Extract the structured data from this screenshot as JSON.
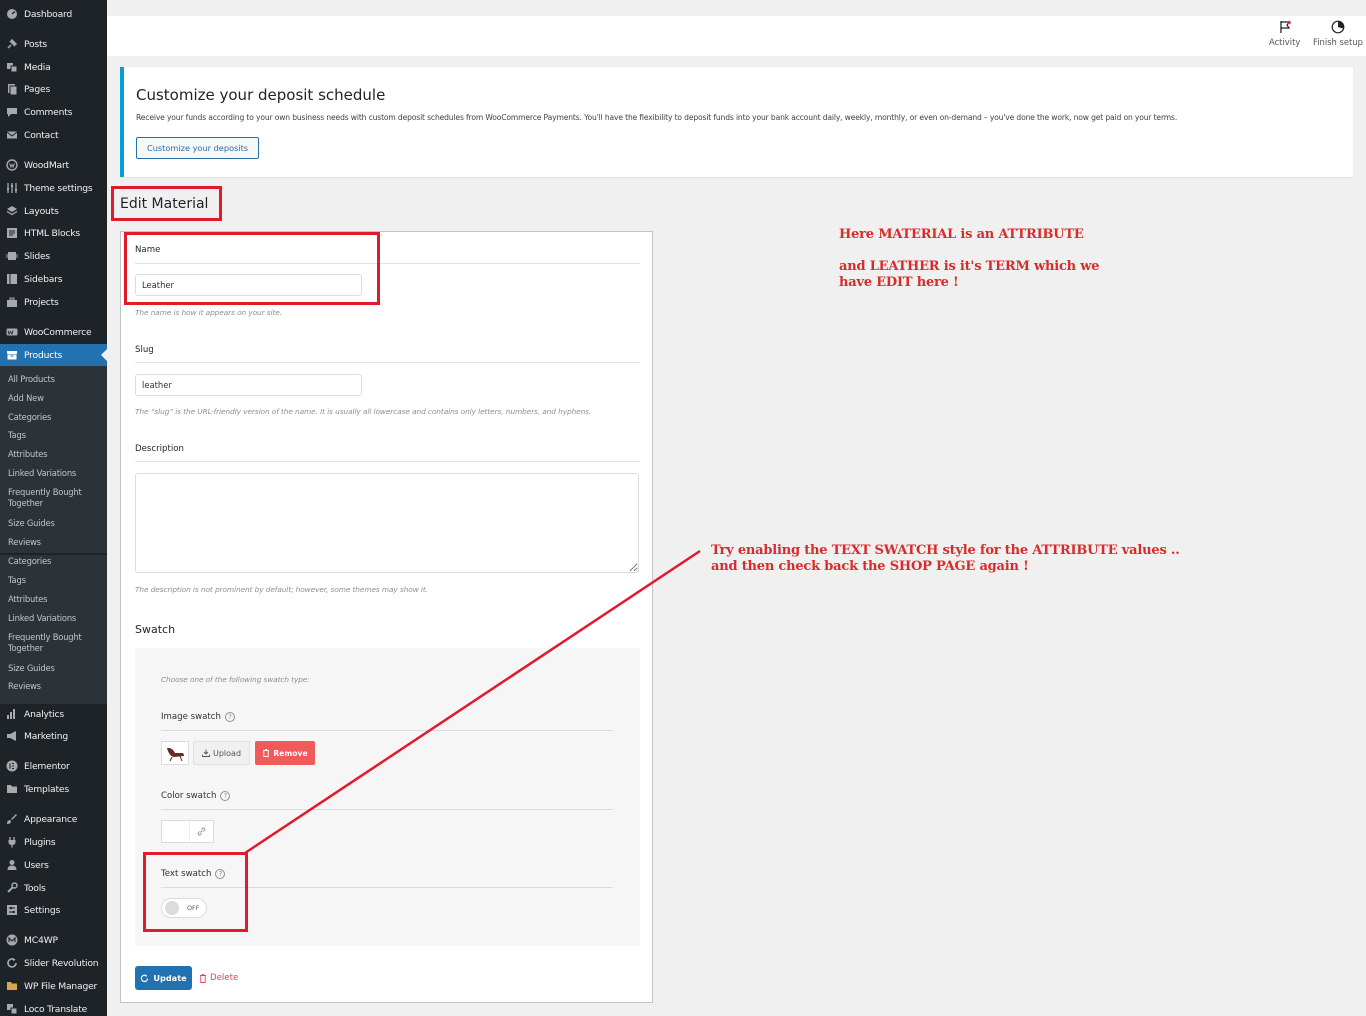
{
  "sidebar": {
    "items": [
      {
        "label": "Dashboard",
        "icon": "dashboard-icon"
      },
      {
        "label": "Posts",
        "icon": "pin-icon"
      },
      {
        "label": "Media",
        "icon": "media-icon"
      },
      {
        "label": "Pages",
        "icon": "pages-icon"
      },
      {
        "label": "Comments",
        "icon": "comment-icon"
      },
      {
        "label": "Contact",
        "icon": "mail-icon"
      },
      {
        "label": "WoodMart",
        "icon": "woodmart-icon"
      },
      {
        "label": "Theme settings",
        "icon": "sliders-icon"
      },
      {
        "label": "Layouts",
        "icon": "layers-icon"
      },
      {
        "label": "HTML Blocks",
        "icon": "block-icon"
      },
      {
        "label": "Slides",
        "icon": "slides-icon"
      },
      {
        "label": "Sidebars",
        "icon": "sidebar-icon"
      },
      {
        "label": "Projects",
        "icon": "briefcase-icon"
      },
      {
        "label": "WooCommerce",
        "icon": "woocommerce-icon"
      },
      {
        "label": "Products",
        "icon": "archive-icon"
      },
      {
        "label": "Analytics",
        "icon": "chart-bar-icon"
      },
      {
        "label": "Marketing",
        "icon": "megaphone-icon"
      },
      {
        "label": "Elementor",
        "icon": "elementor-icon"
      },
      {
        "label": "Templates",
        "icon": "folder-icon"
      },
      {
        "label": "Appearance",
        "icon": "brush-icon"
      },
      {
        "label": "Plugins",
        "icon": "plug-icon"
      },
      {
        "label": "Users",
        "icon": "user-icon"
      },
      {
        "label": "Tools",
        "icon": "wrench-icon"
      },
      {
        "label": "Settings",
        "icon": "settings-icon"
      },
      {
        "label": "MC4WP",
        "icon": "mc4wp-icon"
      },
      {
        "label": "Slider Revolution",
        "icon": "refresh-icon"
      },
      {
        "label": "WP File Manager",
        "icon": "file-manager-icon"
      },
      {
        "label": "Loco Translate",
        "icon": "translate-icon"
      }
    ],
    "submenu": [
      "All Products",
      "Add New",
      "Categories",
      "Tags",
      "Attributes",
      "Linked Variations",
      "Frequently Bought Together",
      "Size Guides",
      "Reviews"
    ],
    "submenu_repeat": [
      "Categories",
      "Tags",
      "Attributes",
      "Linked Variations",
      "Frequently Bought Together",
      "Size Guides",
      "Reviews"
    ]
  },
  "topbar": {
    "activity": "Activity",
    "finish_setup": "Finish setup"
  },
  "notice": {
    "title": "Customize your deposit schedule",
    "text": "Receive your funds according to your own business needs with custom deposit schedules from WooCommerce Payments. You'll have the flexibility to deposit funds into your bank account daily, weekly, monthly, or even on-demand – you've done the work, now get paid on your terms.",
    "button": "Customize your deposits"
  },
  "page": {
    "heading": "Edit Material"
  },
  "form": {
    "name_label": "Name",
    "name_value": "Leather",
    "name_help": "The name is how it appears on your site.",
    "slug_label": "Slug",
    "slug_value": "leather",
    "slug_help": "The “slug” is the URL-friendly version of the name. It is usually all lowercase and contains only letters, numbers, and hyphens.",
    "description_label": "Description",
    "description_help": "The description is not prominent by default; however, some themes may show it.",
    "swatch_title": "Swatch",
    "swatch_intro": "Choose one of the following swatch type:",
    "image_swatch": "Image swatch",
    "upload": "Upload",
    "remove": "Remove",
    "color_swatch": "Color swatch",
    "text_swatch": "Text swatch",
    "toggle_state": "OFF",
    "update": "Update",
    "delete": "Delete"
  },
  "annotations": {
    "a1": "Here MATERIAL is an ATTRIBUTE",
    "a2_line1": "and LEATHER is it's TERM which we",
    "a2_line2": "have EDIT here !",
    "a3_line1": "Try enabling the TEXT SWATCH style for the ATTRIBUTE values ..",
    "a3_line2": "and then check back  the SHOP PAGE again !"
  },
  "colors": {
    "sidebar_bg": "#1d2327",
    "submenu_bg": "#2c3338",
    "active": "#2271b1",
    "notice_border": "#00a0d2",
    "annotation_red": "#e21b2b",
    "remove_button": "#f05a5a"
  }
}
